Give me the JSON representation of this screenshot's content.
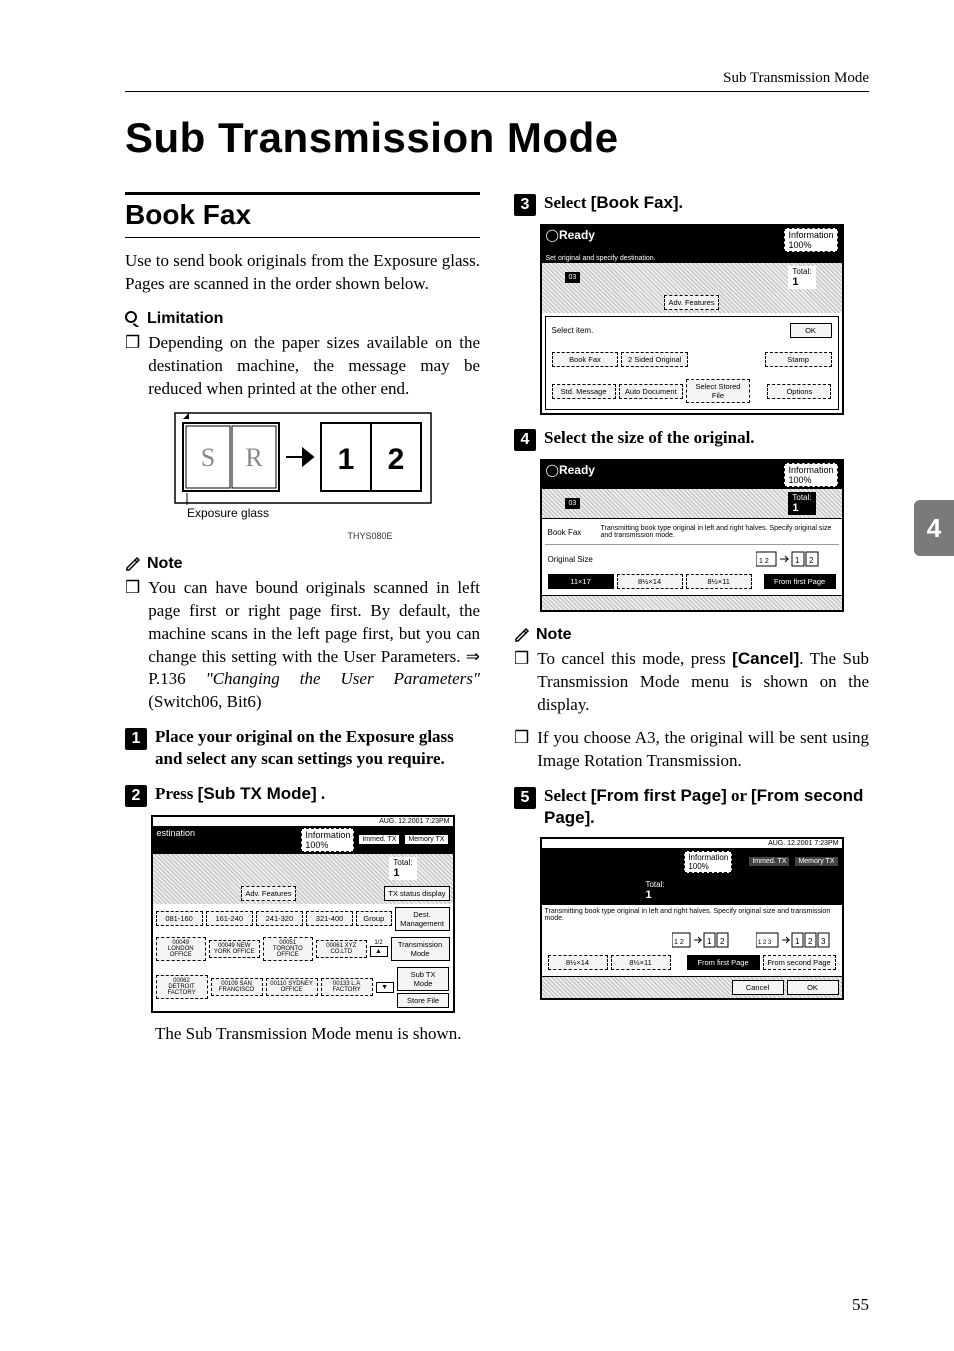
{
  "running_head": "Sub Transmission Mode",
  "title": "Sub Transmission Mode",
  "side_tab": "4",
  "page_number": "55",
  "section": {
    "heading": "Book Fax"
  },
  "intro": "Use to send book originals from the Exposure glass. Pages are scanned in the order shown below.",
  "limitation": {
    "heading": "Limitation",
    "item": "Depending on the paper sizes available on the destination machine, the message may be reduced when printed at the other end."
  },
  "diagram": {
    "label_exposure": "Exposure glass",
    "tile_s": "S",
    "tile_r": "R",
    "tile_1": "1",
    "tile_2": "2",
    "code": "THYS080E"
  },
  "note1": {
    "heading": "Note",
    "item": "You can have bound originals scanned in left page first or right page first. By default, the machine scans in the left page first, but you can change this setting with the User Parameters. ⇒ P.136 ",
    "ref": "\"Changing the User Parameters\"",
    "suffix": "(Switch06, Bit6)"
  },
  "steps": {
    "s1": {
      "num": "1",
      "text_a": "Place your original on the Exposure glass and select any scan settings you require."
    },
    "s2": {
      "num": "2",
      "text_a": "Press ",
      "btn": "[Sub TX Mode]",
      "text_b": " ."
    },
    "s2_after": "The Sub Transmission Mode menu is shown.",
    "s3": {
      "num": "3",
      "text_a": "Select ",
      "btn": "[Book Fax]",
      "text_b": "."
    },
    "s4": {
      "num": "4",
      "text_a": "Select the size of the original."
    },
    "s5": {
      "num": "5",
      "text_a": "Select ",
      "btn1": "[From first Page]",
      "mid": " or ",
      "btn2": "[From second Page]",
      "text_b": "."
    }
  },
  "note2": {
    "heading": "Note",
    "item1_a": "To cancel this mode, press ",
    "item1_btn": "[Cancel]",
    "item1_b": ". The Sub Transmission Mode menu is shown on the display.",
    "item2": "If you choose A3, the original will be sent using Image Rotation Transmission."
  },
  "ss_common": {
    "timestamp": "AUG.   12.2001   7:23PM",
    "ready": "Ready",
    "information": "Information",
    "percent": "100%",
    "total": "Total:",
    "total_val": "1"
  },
  "ss2": {
    "prompt": "estination",
    "immed": "Immed. TX",
    "memory": "Memory TX",
    "adv": "Adv. Features",
    "tx_status": "TX status display",
    "tabs": [
      "081-160",
      "161-240",
      "241-320",
      "321-400",
      "Group"
    ],
    "dest_mgmt": "Dest. Management",
    "row1": [
      "00049 LONDON OFFICE",
      "00049 NEW YORK OFFICE",
      "00051 TORONTO OFFICE",
      "00061 XYZ CO.LTD"
    ],
    "row2": [
      "00062 DETROIT FACTORY",
      "00109 SAN FRANCISCO",
      "00110 SYDNEY OFFICE",
      "00133 L.A FACTORY"
    ],
    "nav": "1/2",
    "up": "▲",
    "down": "▼",
    "side": [
      "Transmission Mode",
      "Sub TX Mode",
      "Store File"
    ]
  },
  "ss3": {
    "prompt": "Set original and specify destination.",
    "pg": "03",
    "adv": "Adv. Features",
    "select": "Select item.",
    "ok": "OK",
    "btns": [
      "Book Fax",
      "2 Sided Original",
      "Stamp",
      "Std. Message",
      "Auto Document",
      "Select Stored File",
      "Options"
    ]
  },
  "ss4": {
    "pg": "03",
    "label": "Book Fax",
    "desc": "Transmitting book type original in left and right halves. Specify original size and transmission mode.",
    "orig_size": "Original Size",
    "sizes": [
      "11×17",
      "8½×14",
      "8½×11"
    ],
    "from_first": "From first Page"
  },
  "ss5": {
    "immed": "Immed. TX",
    "memory": "Memory TX",
    "desc": "Transmitting book type original in left and right halves. Specify original size and transmission mode.",
    "sizes": [
      "8½×14",
      "8½×11"
    ],
    "from_first": "From first Page",
    "from_second": "From second Page",
    "cancel": "Cancel",
    "ok": "OK"
  }
}
